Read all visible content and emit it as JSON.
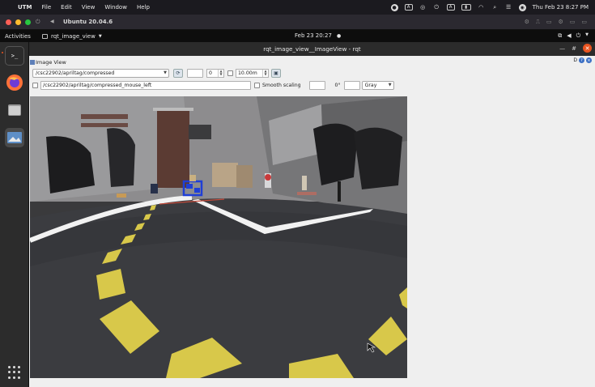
{
  "mac_menubar": {
    "app_name": "UTM",
    "menus": [
      "File",
      "Edit",
      "View",
      "Window",
      "Help"
    ],
    "clock": "Thu Feb 23  8:27 PM",
    "status_icons": [
      "record-icon",
      "a-box-icon",
      "globe-icon",
      "power-icon",
      "keyboard-a-icon",
      "battery-icon",
      "wifi-icon",
      "search-icon",
      "control-center-icon",
      "siri-icon"
    ]
  },
  "vm_window": {
    "title": "Ubuntu 20.04.6"
  },
  "ubuntu_topbar": {
    "activities": "Activities",
    "app_menu": "rqt_image_view",
    "clock": "Feb 23  20:27",
    "indicator": "●"
  },
  "rqt_window": {
    "title": "rqt_image_view__ImageView - rqt",
    "plugin_title": "Image View",
    "plugin_badge": "D"
  },
  "toolbar1": {
    "topic": "/csc22902/apriltag/compressed",
    "field_empty": "",
    "spin_value": "0",
    "timeout": "10.00m"
  },
  "toolbar2": {
    "mouse_topic": "/csc22902/apriltag/compressed_mouse_left",
    "smooth_label": "Smooth scaling",
    "rotation": "0°",
    "color_scheme": "Gray"
  },
  "colors": {
    "ubuntu_orange": "#e95420",
    "road_yellow": "#d8c84a",
    "road_white": "#f2f2f2",
    "apriltag_blue": "#1f3fd6"
  }
}
